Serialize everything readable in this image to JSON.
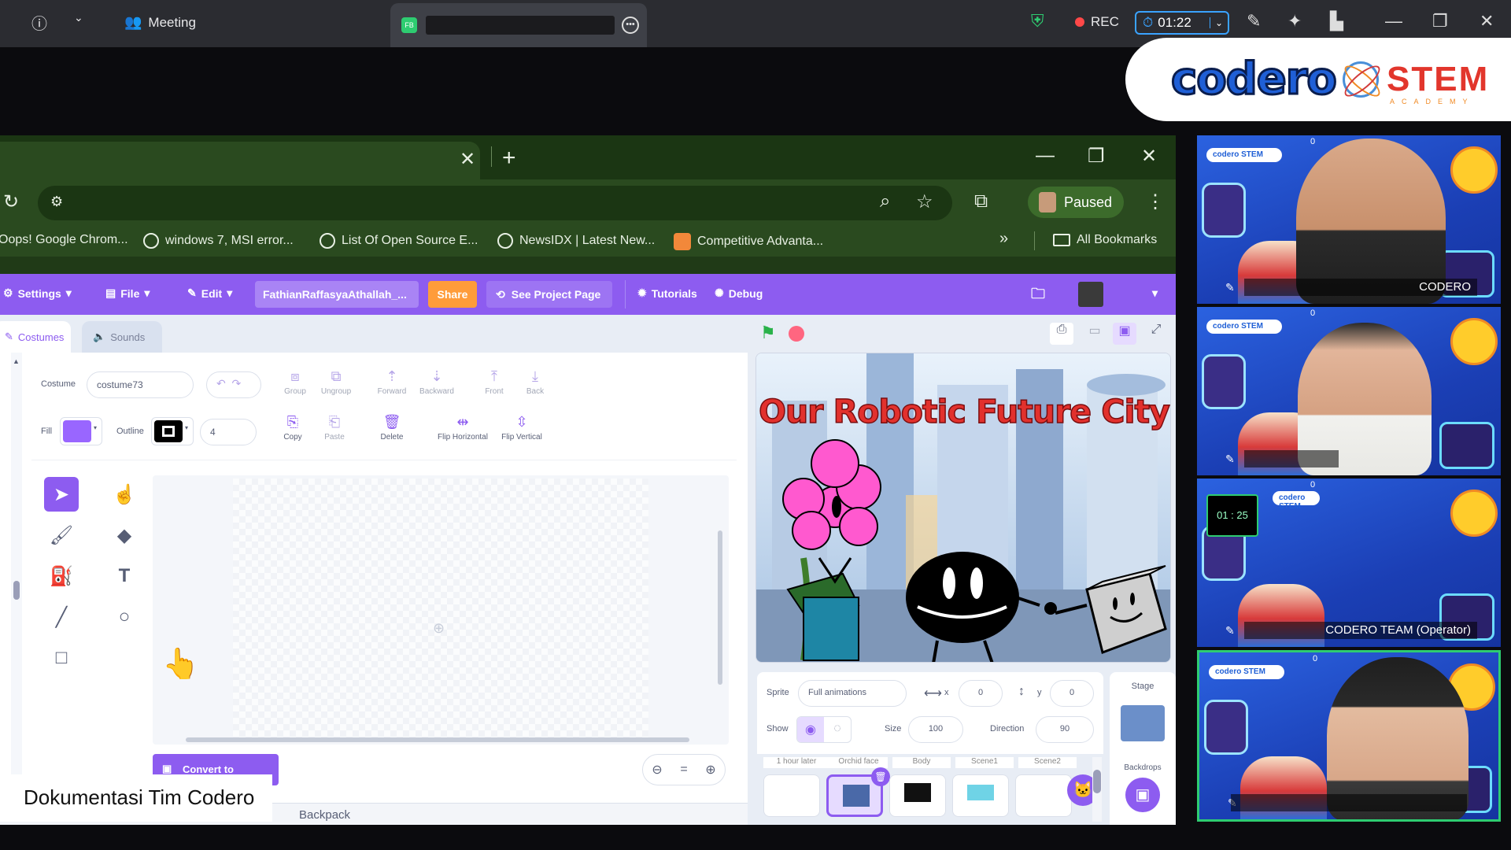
{
  "meeting": {
    "title": "Meeting",
    "rec_label": "REC",
    "timer": "01:22",
    "share_badge": "FB"
  },
  "logos": {
    "codero": "codero",
    "stem": "STEM",
    "stem_sub": "ACADEMY"
  },
  "browser": {
    "paused_label": "Paused",
    "bookmarks": [
      "Oops! Google Chrom...",
      "windows 7, MSI error...",
      "List Of Open Source E...",
      "NewsIDX | Latest New...",
      "Competitive Advanta..."
    ],
    "all_bookmarks": "All Bookmarks"
  },
  "scratch": {
    "menu": {
      "settings": "Settings",
      "file": "File",
      "edit": "Edit",
      "project_title": "FathianRaffasyaAthallah_...",
      "share": "Share",
      "see_project": "See Project Page",
      "tutorials": "Tutorials",
      "debug": "Debug"
    },
    "tabs": {
      "costumes": "Costumes",
      "sounds": "Sounds"
    },
    "paint": {
      "costume_label": "Costume",
      "costume_name": "costume73",
      "fill_label": "Fill",
      "outline_label": "Outline",
      "outline_width": "4",
      "tools": {
        "group": "Group",
        "ungroup": "Ungroup",
        "forward": "Forward",
        "backward": "Backward",
        "front": "Front",
        "back": "Back",
        "copy": "Copy",
        "paste": "Paste",
        "delete": "Delete",
        "flip_h": "Flip Horizontal",
        "flip_v": "Flip Vertical"
      },
      "convert": "Convert to Bitmap",
      "backpack": "Backpack",
      "fill_color": "#9966ff"
    },
    "stage": {
      "title_text": "Our Robotic Future City"
    },
    "sprite": {
      "sprite_label": "Sprite",
      "sprite_name": "Full animations",
      "x_label": "x",
      "x_value": "0",
      "y_label": "y",
      "y_value": "0",
      "show_label": "Show",
      "size_label": "Size",
      "size_value": "100",
      "direction_label": "Direction",
      "direction_value": "90",
      "stage_label": "Stage",
      "backdrops_label": "Backdrops",
      "tiles": [
        "1 hour later",
        "Orchid face",
        "Body",
        "Scene1",
        "Scene2"
      ]
    }
  },
  "participants": {
    "tile1_name": "CODERO",
    "tile3_timer": "01 : 25",
    "tile3_name": "CODERO TEAM (Operator)",
    "tile_brand": "codero STEM",
    "zero": "0"
  },
  "caption": "Dokumentasi Tim Codero"
}
